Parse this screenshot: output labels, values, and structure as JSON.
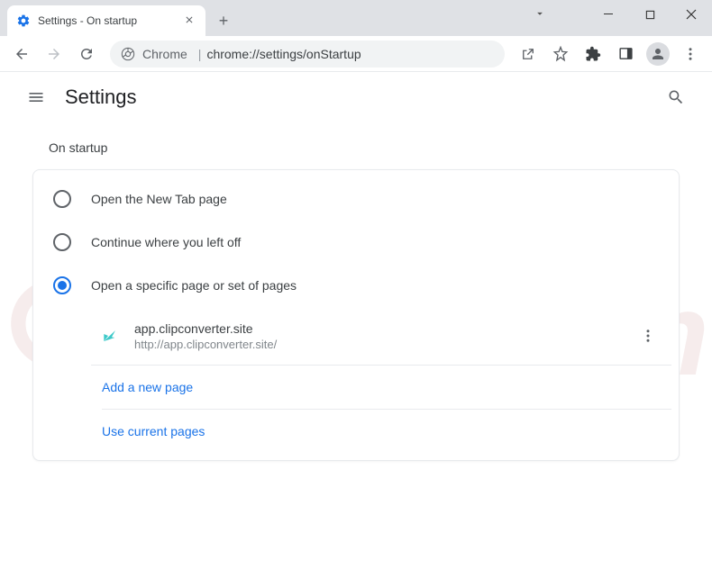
{
  "window": {
    "tab_title": "Settings - On startup"
  },
  "address_bar": {
    "scheme_label": "Chrome",
    "url": "chrome://settings/onStartup"
  },
  "header": {
    "title": "Settings"
  },
  "section": {
    "title": "On startup",
    "options": {
      "open_new_tab": "Open the New Tab page",
      "continue": "Continue where you left off",
      "specific": "Open a specific page or set of pages"
    },
    "pages": [
      {
        "name": "app.clipconverter.site",
        "url": "http://app.clipconverter.site/"
      }
    ],
    "add_page": "Add a new page",
    "use_current": "Use current pages"
  },
  "watermark": "PCrisk.com"
}
